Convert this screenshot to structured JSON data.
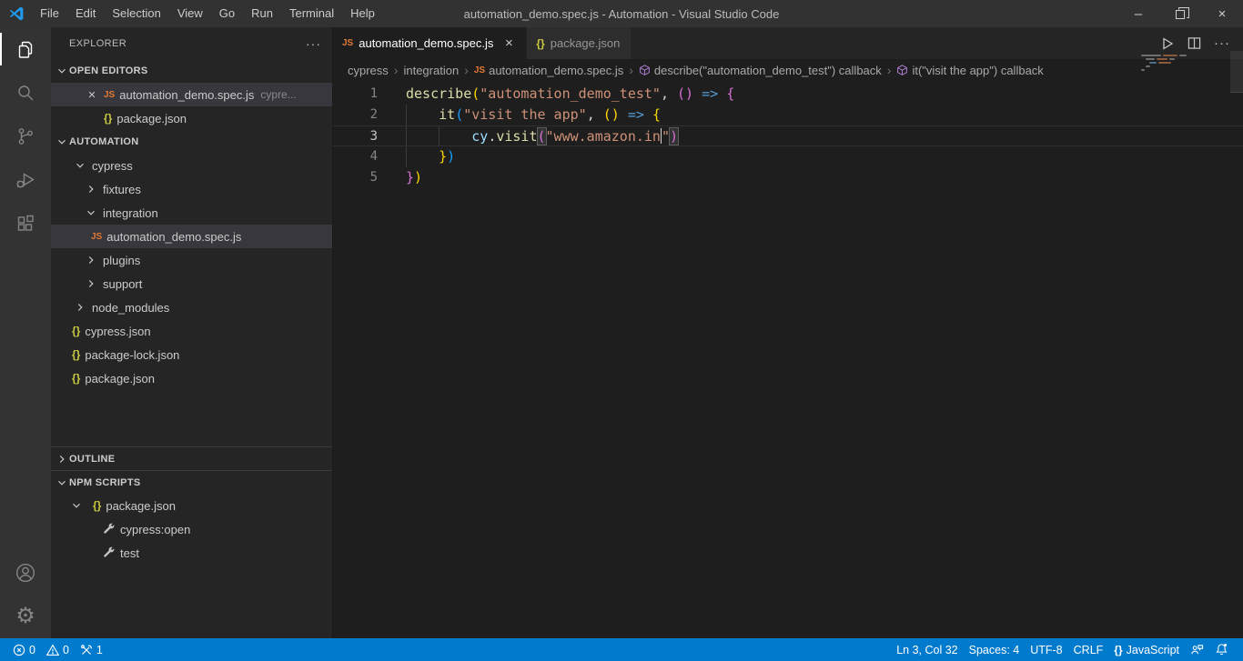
{
  "window": {
    "menus": [
      "File",
      "Edit",
      "Selection",
      "View",
      "Go",
      "Run",
      "Terminal",
      "Help"
    ],
    "title": "automation_demo.spec.js - Automation - Visual Studio Code",
    "controls": {
      "minimize": "–",
      "close": "×"
    }
  },
  "icons": {
    "js": "JS",
    "braces": "{}",
    "ellipsis": "···",
    "close": "×",
    "gear": "⚙"
  },
  "explorer": {
    "title": "EXPLORER",
    "open_editors": {
      "title": "OPEN EDITORS",
      "items": [
        {
          "name": "automation_demo.spec.js",
          "detail": "cypre..."
        },
        {
          "name": "package.json"
        }
      ]
    },
    "workspace": {
      "title": "AUTOMATION",
      "items": [
        {
          "label": "cypress"
        },
        {
          "label": "fixtures"
        },
        {
          "label": "integration"
        },
        {
          "label": "automation_demo.spec.js"
        },
        {
          "label": "plugins"
        },
        {
          "label": "support"
        },
        {
          "label": "node_modules"
        },
        {
          "label": "cypress.json"
        },
        {
          "label": "package-lock.json"
        },
        {
          "label": "package.json"
        }
      ]
    },
    "outline": {
      "title": "OUTLINE"
    },
    "npm_scripts": {
      "title": "NPM SCRIPTS",
      "package": "package.json",
      "scripts": [
        "cypress:open",
        "test"
      ]
    }
  },
  "editor": {
    "tabs": [
      {
        "label": "automation_demo.spec.js"
      },
      {
        "label": "package.json"
      }
    ],
    "breadcrumbs": {
      "path": [
        "cypress",
        "integration",
        "automation_demo.spec.js"
      ],
      "symbols": [
        "describe(\"automation_demo_test\") callback",
        "it(\"visit the app\") callback"
      ]
    },
    "lines": [
      {
        "num": "1",
        "tokens": [
          "describe",
          "(",
          "\"automation_demo_test\"",
          ", ",
          "()",
          " ",
          "=>",
          " ",
          "{"
        ]
      },
      {
        "num": "2",
        "tokens": [
          "    ",
          "it",
          "(",
          "\"visit the app\"",
          ", ",
          "()",
          " ",
          "=>",
          " ",
          "{"
        ]
      },
      {
        "num": "3",
        "tokens": [
          "        ",
          "cy",
          ".",
          "visit",
          "(",
          "\"www.amazon.in",
          "\"",
          ")"
        ]
      },
      {
        "num": "4",
        "tokens": [
          "    ",
          "}",
          ")"
        ]
      },
      {
        "num": "5",
        "tokens": [
          "}",
          ")"
        ]
      }
    ]
  },
  "status_bar": {
    "errors": "0",
    "warnings": "0",
    "tasks": "1",
    "cursor_position": "Ln 3, Col 32",
    "indentation": "Spaces: 4",
    "encoding": "UTF-8",
    "eol": "CRLF",
    "language": "JavaScript"
  }
}
